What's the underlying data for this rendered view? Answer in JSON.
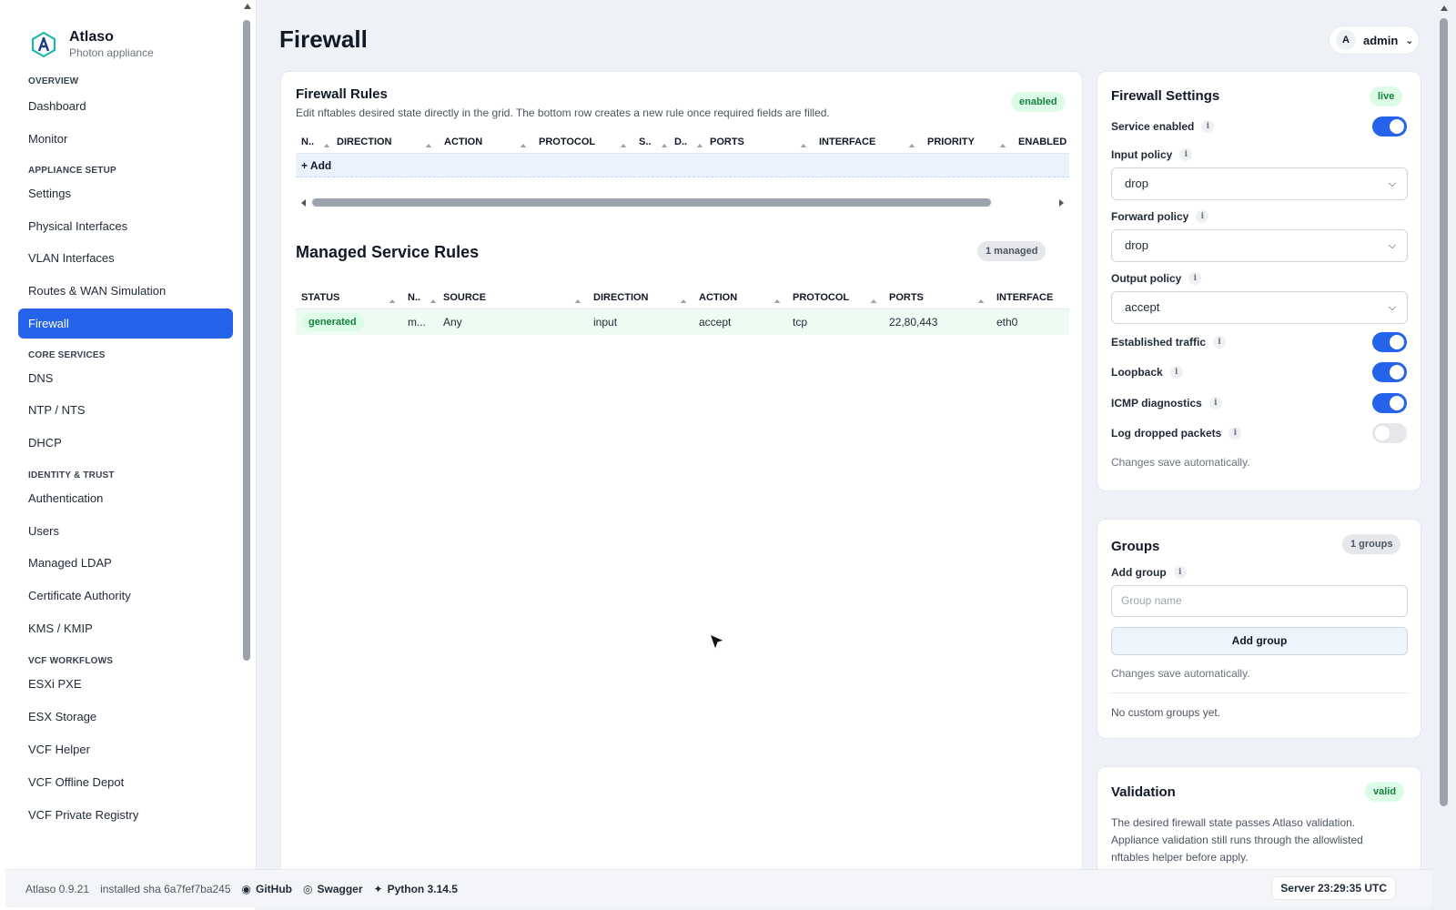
{
  "brand": {
    "name": "Atlaso",
    "subtitle": "Photon appliance"
  },
  "sidebar": {
    "sections": [
      {
        "title": "OVERVIEW",
        "items": [
          "Dashboard",
          "Monitor"
        ]
      },
      {
        "title": "APPLIANCE SETUP",
        "items": [
          "Settings",
          "Physical Interfaces",
          "VLAN Interfaces",
          "Routes & WAN Simulation",
          "Firewall"
        ]
      },
      {
        "title": "CORE SERVICES",
        "items": [
          "DNS",
          "NTP / NTS",
          "DHCP"
        ]
      },
      {
        "title": "IDENTITY & TRUST",
        "items": [
          "Authentication",
          "Users",
          "Managed LDAP",
          "Certificate Authority",
          "KMS / KMIP"
        ]
      },
      {
        "title": "VCF WORKFLOWS",
        "items": [
          "ESXi PXE",
          "ESX Storage",
          "VCF Helper",
          "VCF Offline Depot",
          "VCF Private Registry"
        ]
      }
    ],
    "active_item": "Firewall"
  },
  "header": {
    "title": "Firewall",
    "user": "admin",
    "avatar_initial": "A"
  },
  "firewall_rules": {
    "title": "Firewall Rules",
    "description": "Edit nftables desired state directly in the grid. The bottom row creates a new rule once required fields are filled.",
    "status_badge": "enabled",
    "columns": [
      "N..",
      "DIRECTION",
      "ACTION",
      "PROTOCOL",
      "S..",
      "D..",
      "PORTS",
      "INTERFACE",
      "PRIORITY",
      "ENABLED"
    ],
    "add_row_label": "+ Add"
  },
  "managed_rules": {
    "title": "Managed Service Rules",
    "count_badge": "1 managed",
    "columns": [
      "STATUS",
      "N..",
      "SOURCE",
      "DIRECTION",
      "ACTION",
      "PROTOCOL",
      "PORTS",
      "INTERFACE"
    ],
    "rows": [
      {
        "status": "generated",
        "name": "m...",
        "source": "Any",
        "direction": "input",
        "action": "accept",
        "protocol": "tcp",
        "ports": "22,80,443",
        "interface": "eth0"
      }
    ]
  },
  "firewall_settings": {
    "title": "Firewall Settings",
    "badge": "live",
    "service_enabled": {
      "label": "Service enabled",
      "on": true
    },
    "input_policy": {
      "label": "Input policy",
      "value": "drop"
    },
    "forward_policy": {
      "label": "Forward policy",
      "value": "drop"
    },
    "output_policy": {
      "label": "Output policy",
      "value": "accept"
    },
    "established": {
      "label": "Established traffic",
      "on": true
    },
    "loopback": {
      "label": "Loopback",
      "on": true
    },
    "icmp": {
      "label": "ICMP diagnostics",
      "on": true
    },
    "log_dropped": {
      "label": "Log dropped packets",
      "on": false
    },
    "note": "Changes save automatically."
  },
  "groups": {
    "title": "Groups",
    "badge": "1 groups",
    "add_label": "Add group",
    "placeholder": "Group name",
    "button": "Add group",
    "note": "Changes save automatically.",
    "empty": "No custom groups yet."
  },
  "validation": {
    "title": "Validation",
    "badge": "valid",
    "text": "The desired firewall state passes Atlaso validation. Appliance validation still runs through the allowlisted nftables helper before apply."
  },
  "footer": {
    "version": "Atlaso 0.9.21",
    "sha": "installed sha 6a7fef7ba245",
    "github": "GitHub",
    "swagger": "Swagger",
    "python": "Python 3.14.5",
    "server_time": "Server 23:29:35 UTC"
  },
  "colors": {
    "accent": "#2563eb",
    "success_bg": "#dcfce7",
    "success_text": "#15803d"
  }
}
